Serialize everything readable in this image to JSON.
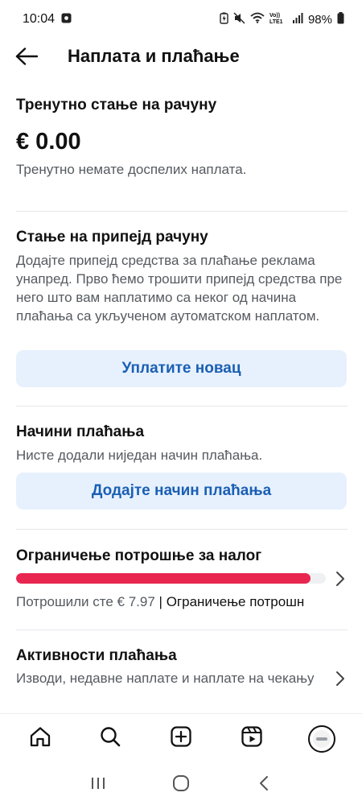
{
  "status_bar": {
    "time": "10:04",
    "battery": "98%",
    "network": "Vo)) LTE1"
  },
  "header": {
    "title": "Наплата и плаћање"
  },
  "balance": {
    "title": "Тренутно стање на рачуну",
    "amount": "€ 0.00",
    "note": "Тренутно немате доспелих наплата."
  },
  "prepaid": {
    "title": "Стање на припејд рачуну",
    "description": "Додајте припејд средства за плаћање реклама унапред. Прво ћемо трошити припејд средства пре него што вам наплатимо са неког од начина плаћања са укљученом аутоматском наплатом.",
    "button_label": "Уплатите новац"
  },
  "payment_methods": {
    "title": "Начини плаћања",
    "description": "Нисте додали ниједан начин плаћања.",
    "button_label": "Додајте начин плаћања"
  },
  "spending_limit": {
    "title": "Ограничење потрошње за налог",
    "spent_text": "Потрошили сте € 7.97",
    "separator": "|",
    "link_text": "Ограничење потрошн",
    "progress_fraction": 0.95,
    "accent_color": "#e8264f"
  },
  "payment_activity": {
    "title": "Активности плаћања",
    "description": "Изводи, недавне наплате и наплате на чекању"
  },
  "bottom_nav": {
    "items": [
      "home-icon",
      "search-icon",
      "create-icon",
      "reels-icon",
      "profile-avatar"
    ]
  },
  "colors": {
    "button_bg": "#e7f1fd",
    "button_text": "#1a5fb4",
    "text_secondary": "#555a60"
  }
}
